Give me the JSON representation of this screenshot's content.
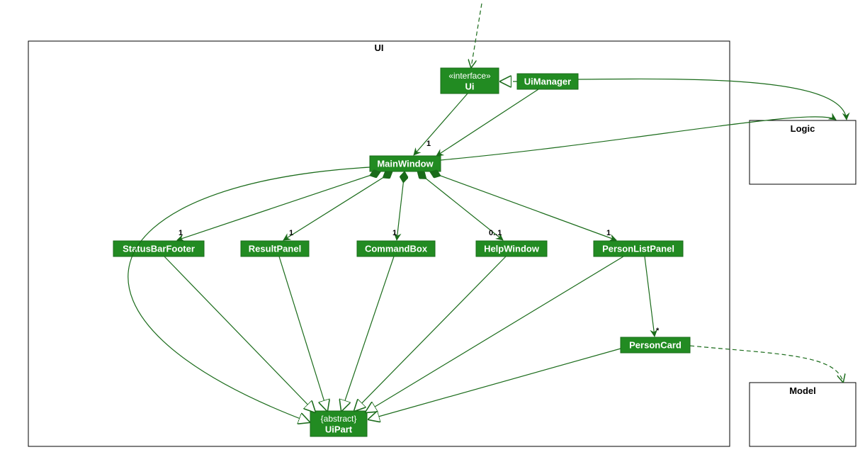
{
  "packages": {
    "ui": {
      "label": "UI"
    },
    "logic": {
      "label": "Logic"
    },
    "model": {
      "label": "Model"
    }
  },
  "nodes": {
    "ui_interface": {
      "stereotype": "«interface»",
      "name": "Ui"
    },
    "ui_manager": {
      "name": "UiManager"
    },
    "main_window": {
      "name": "MainWindow"
    },
    "status_bar_footer": {
      "name": "StatusBarFooter"
    },
    "result_panel": {
      "name": "ResultPanel"
    },
    "command_box": {
      "name": "CommandBox"
    },
    "help_window": {
      "name": "HelpWindow"
    },
    "person_list_panel": {
      "name": "PersonListPanel"
    },
    "person_card": {
      "name": "PersonCard"
    },
    "ui_part": {
      "stereotype": "{abstract}",
      "name": "UiPart"
    }
  },
  "multiplicities": {
    "main_window": "1",
    "status_bar_footer": "1",
    "result_panel": "1",
    "command_box": "1",
    "help_window": "0..1",
    "person_list_panel": "1",
    "person_card": "*"
  },
  "chart_data": {
    "type": "uml_class_diagram",
    "packages": [
      "UI",
      "Logic",
      "Model"
    ],
    "classes": [
      {
        "name": "Ui",
        "stereotype": "interface",
        "package": "UI"
      },
      {
        "name": "UiManager",
        "package": "UI"
      },
      {
        "name": "MainWindow",
        "package": "UI"
      },
      {
        "name": "StatusBarFooter",
        "package": "UI"
      },
      {
        "name": "ResultPanel",
        "package": "UI"
      },
      {
        "name": "CommandBox",
        "package": "UI"
      },
      {
        "name": "HelpWindow",
        "package": "UI"
      },
      {
        "name": "PersonListPanel",
        "package": "UI"
      },
      {
        "name": "PersonCard",
        "package": "UI"
      },
      {
        "name": "UiPart",
        "stereotype": "abstract",
        "package": "UI"
      },
      {
        "name": "Logic",
        "package": "Logic"
      },
      {
        "name": "Model",
        "package": "Model"
      }
    ],
    "relations": [
      {
        "from": "external",
        "to": "Ui",
        "type": "dependency"
      },
      {
        "from": "UiManager",
        "to": "Ui",
        "type": "realization"
      },
      {
        "from": "UiManager",
        "to": "MainWindow",
        "type": "association",
        "multiplicity": "1"
      },
      {
        "from": "UiManager",
        "to": "Logic",
        "type": "association"
      },
      {
        "from": "MainWindow",
        "to": "Logic",
        "type": "association"
      },
      {
        "from": "MainWindow",
        "to": "StatusBarFooter",
        "type": "composition",
        "multiplicity": "1"
      },
      {
        "from": "MainWindow",
        "to": "ResultPanel",
        "type": "composition",
        "multiplicity": "1"
      },
      {
        "from": "MainWindow",
        "to": "CommandBox",
        "type": "composition",
        "multiplicity": "1"
      },
      {
        "from": "MainWindow",
        "to": "HelpWindow",
        "type": "composition",
        "multiplicity": "0..1"
      },
      {
        "from": "MainWindow",
        "to": "PersonListPanel",
        "type": "composition",
        "multiplicity": "1"
      },
      {
        "from": "PersonListPanel",
        "to": "PersonCard",
        "type": "association",
        "multiplicity": "*"
      },
      {
        "from": "PersonCard",
        "to": "Model",
        "type": "dependency"
      },
      {
        "from": "MainWindow",
        "to": "UiPart",
        "type": "generalization"
      },
      {
        "from": "StatusBarFooter",
        "to": "UiPart",
        "type": "generalization"
      },
      {
        "from": "ResultPanel",
        "to": "UiPart",
        "type": "generalization"
      },
      {
        "from": "CommandBox",
        "to": "UiPart",
        "type": "generalization"
      },
      {
        "from": "HelpWindow",
        "to": "UiPart",
        "type": "generalization"
      },
      {
        "from": "PersonListPanel",
        "to": "UiPart",
        "type": "generalization"
      },
      {
        "from": "PersonCard",
        "to": "UiPart",
        "type": "generalization"
      }
    ]
  }
}
